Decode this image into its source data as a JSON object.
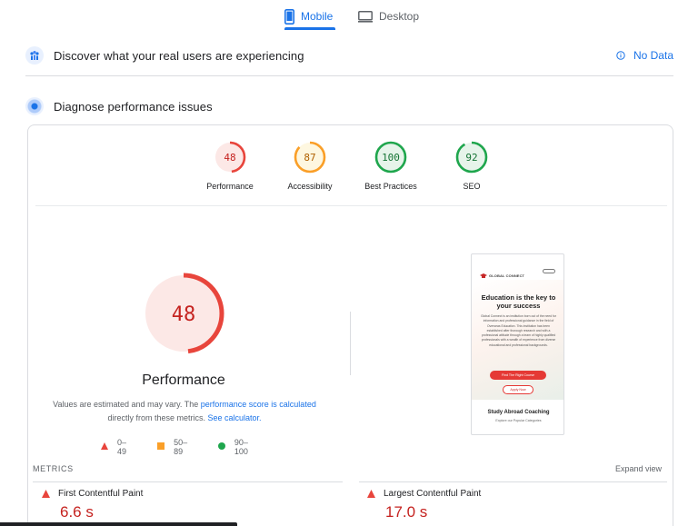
{
  "tabs": [
    {
      "label": "Mobile",
      "icon": "phone-icon",
      "active": true
    },
    {
      "label": "Desktop",
      "icon": "monitor-icon",
      "active": false
    }
  ],
  "field_data": {
    "title": "Discover what your real users are experiencing",
    "status": "No Data",
    "icon": "people-icon",
    "status_icon": "info-icon"
  },
  "diagnose": {
    "title": "Diagnose performance issues",
    "icon": "lab-icon"
  },
  "categories": [
    {
      "label": "Performance",
      "score": "48",
      "color": "#e8453c"
    },
    {
      "label": "Accessibility",
      "score": "87",
      "color": "#fa9f28"
    },
    {
      "label": "Best Practices",
      "score": "100",
      "color": "#1fa64d"
    },
    {
      "label": "SEO",
      "score": "92",
      "color": "#1fa64d"
    }
  ],
  "main_score": {
    "score": "48",
    "title": "Performance",
    "color": "#e8453c",
    "note_1": "Values are estimated and may vary. The ",
    "note_link_1": "performance score is calculated",
    "note_2": " directly from these metrics. ",
    "note_link_2": "See calculator."
  },
  "legend": [
    {
      "range": "0–49",
      "shape": "triangle",
      "color": "#e8453c"
    },
    {
      "range": "50–89",
      "shape": "square",
      "color": "#fa9f28"
    },
    {
      "range": "90–100",
      "shape": "circle",
      "color": "#1fa64d"
    }
  ],
  "screenshot": {
    "brand": "GLOBAL CONNECT",
    "headline": "Education is the key to your success",
    "body": "Global Connect is an institution born out of the need for information and professional guidance in the field of Overseas Education. This institution has been established after thorough research and with a professional attitude through a team of highly qualified professionals with a wealth of experience from diverse educational and professional backgrounds.",
    "button_primary": "Find The Right Course",
    "button_secondary": "Apply Now",
    "section_title": "Study Abroad Coaching",
    "section_sub": "Explore our Popular Categories"
  },
  "metrics": {
    "label": "METRICS",
    "expand": "Expand view",
    "items": [
      {
        "name": "First Contentful Paint",
        "value": "6.6 s",
        "status": "poor"
      },
      {
        "name": "Largest Contentful Paint",
        "value": "17.0 s",
        "status": "poor"
      }
    ]
  }
}
